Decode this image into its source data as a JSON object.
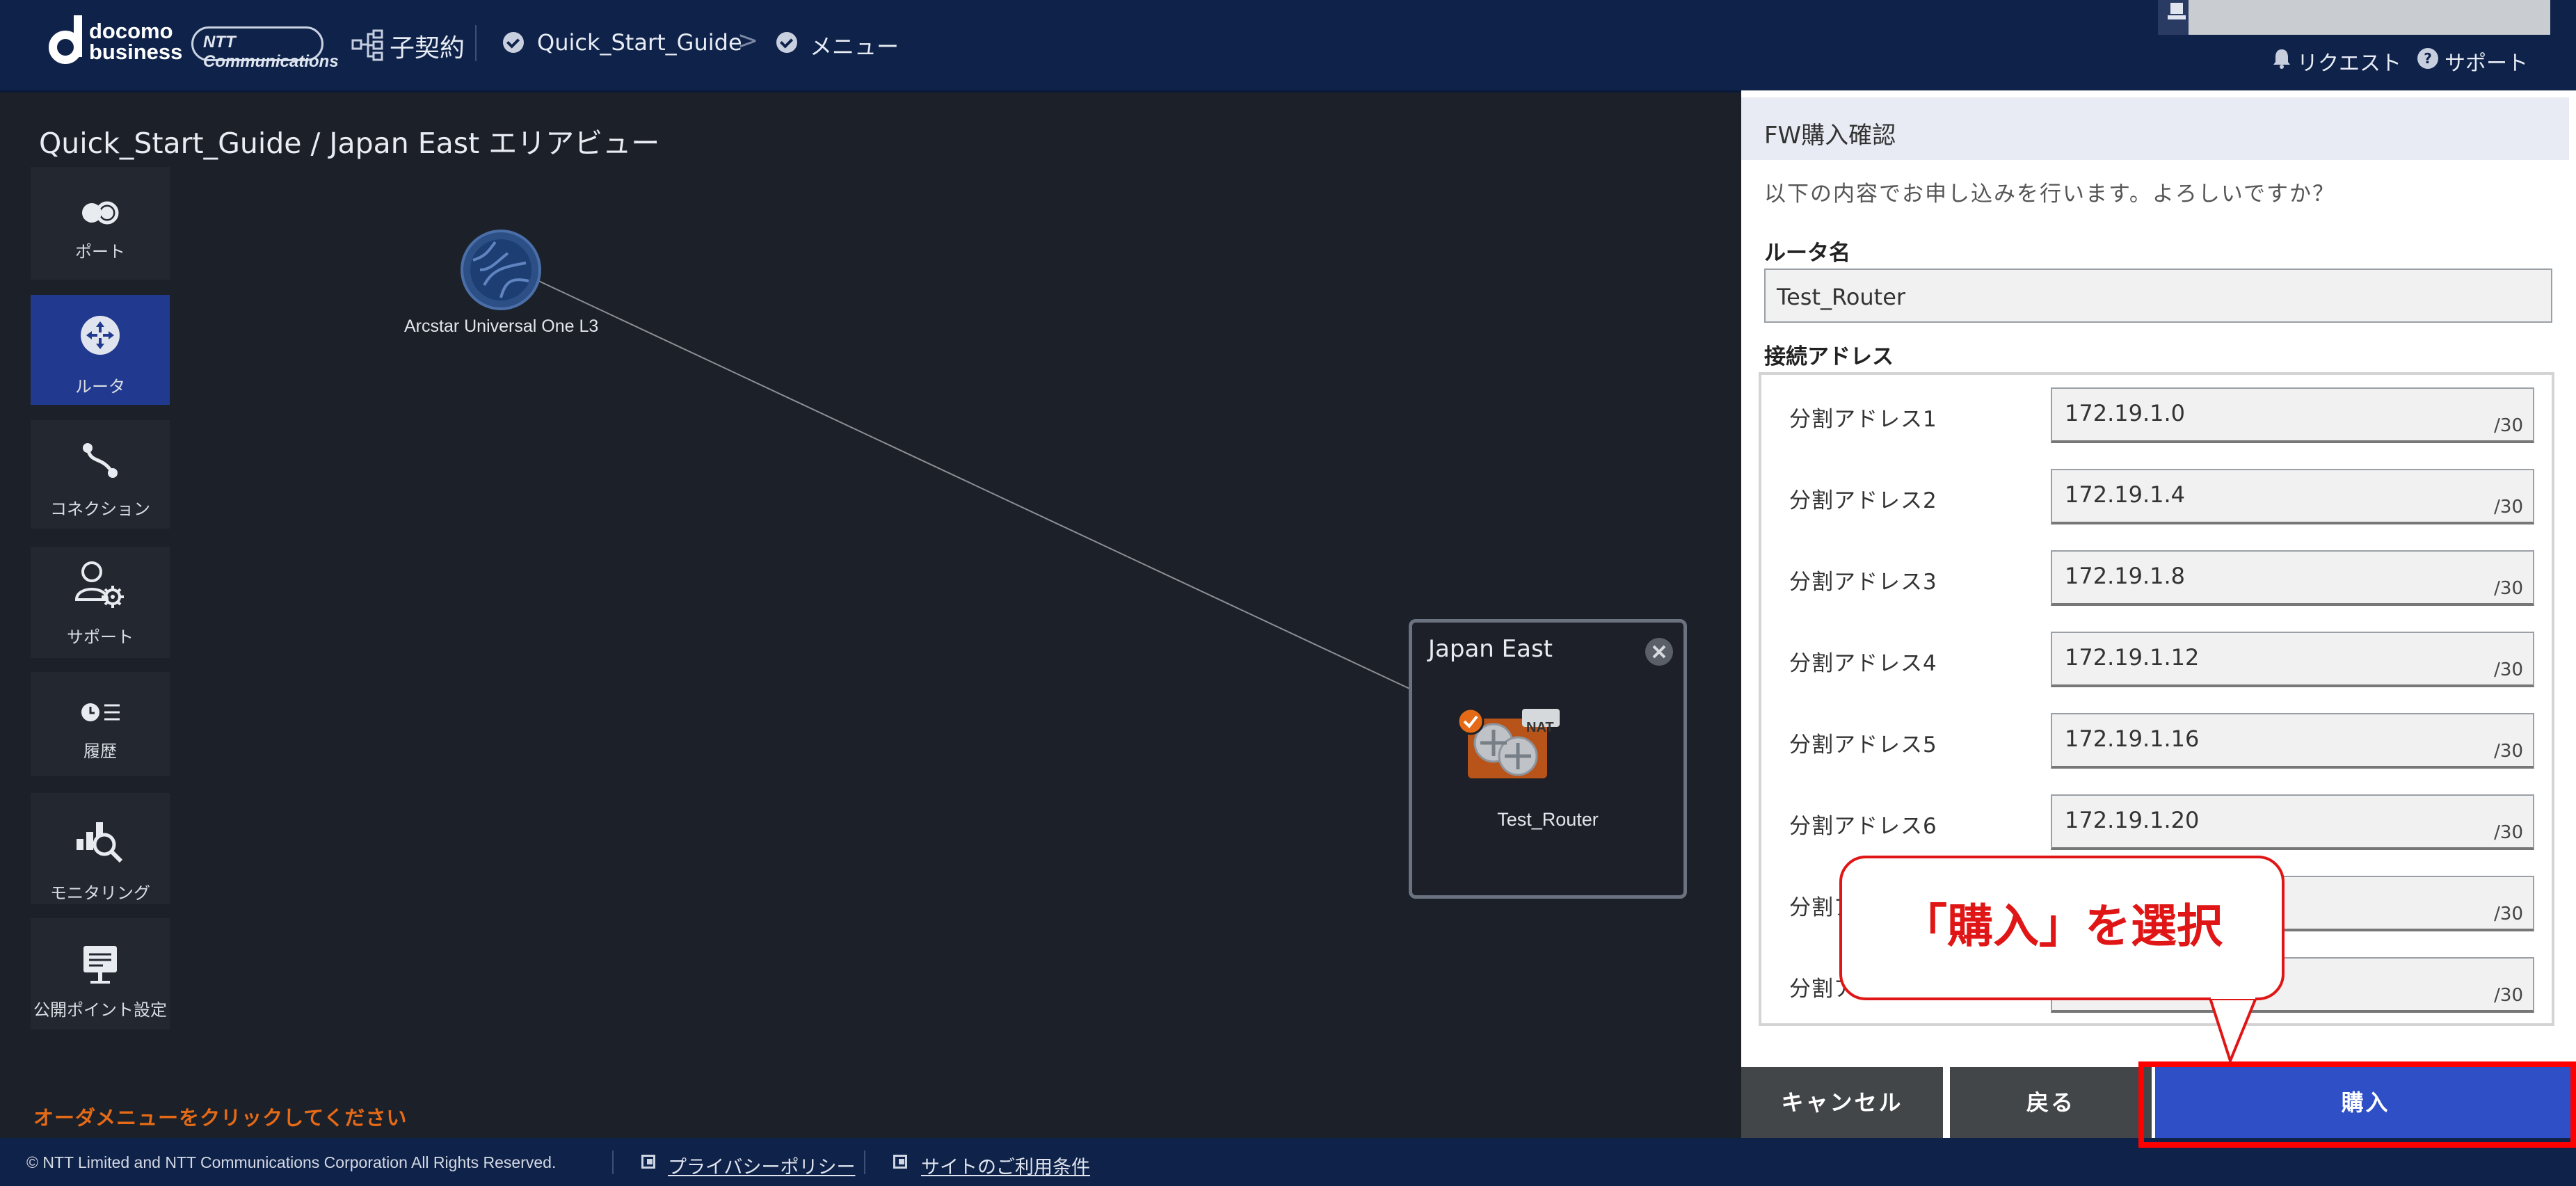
{
  "header": {
    "logo_line1": "docomo",
    "logo_line2": "business",
    "ntt_logo_text": "NTT Communications",
    "contract_label": "子契約",
    "breadcrumb_guide": "Quick_Start_Guide",
    "breadcrumb_separator": ">",
    "menu_label": "メニュー",
    "request_label": "リクエスト",
    "support_label": "サポート"
  },
  "area_title": "Quick_Start_Guide / Japan East エリアビュー",
  "sidebar": {
    "items": [
      {
        "label": "ポート",
        "icon": "port-icon"
      },
      {
        "label": "ルータ",
        "icon": "router-icon",
        "active": true
      },
      {
        "label": "コネクション",
        "icon": "connection-icon"
      },
      {
        "label": "サポート",
        "icon": "support-user-gear-icon"
      },
      {
        "label": "履歴",
        "icon": "history-icon"
      },
      {
        "label": "モニタリング",
        "icon": "monitoring-icon"
      },
      {
        "label": "公開ポイント設定",
        "icon": "public-point-icon"
      }
    ]
  },
  "canvas": {
    "network_node_label": "Arcstar Universal One L3",
    "region_title": "Japan East",
    "router_label": "Test_Router",
    "nat_badge": "NAT"
  },
  "order_hint": "オーダメニューをクリックしてください",
  "footer": {
    "copyright": "© NTT Limited and NTT Communications Corporation All Rights Reserved.",
    "privacy_link": "プライバシーポリシー",
    "terms_link": "サイトのご利用条件"
  },
  "panel": {
    "title": "FW購入確認",
    "confirm_message": "以下の内容でお申し込みを行います。よろしいですか？",
    "router_name_label": "ルータ名",
    "router_name_value": "Test_Router",
    "address_label": "接続アドレス",
    "addresses": [
      {
        "label": "分割アドレス1",
        "value": "172.19.1.0",
        "mask": "/30"
      },
      {
        "label": "分割アドレス2",
        "value": "172.19.1.4",
        "mask": "/30"
      },
      {
        "label": "分割アドレス3",
        "value": "172.19.1.8",
        "mask": "/30"
      },
      {
        "label": "分割アドレス4",
        "value": "172.19.1.12",
        "mask": "/30"
      },
      {
        "label": "分割アドレス5",
        "value": "172.19.1.16",
        "mask": "/30"
      },
      {
        "label": "分割アドレス6",
        "value": "172.19.1.20",
        "mask": "/30"
      },
      {
        "label": "分割ア",
        "value": "",
        "mask": "/30"
      },
      {
        "label": "分割ア",
        "value": "",
        "mask": "/30"
      }
    ],
    "cancel_label": "キャンセル",
    "back_label": "戻る",
    "buy_label": "購入"
  },
  "callout_text": "「購入」を選択",
  "colors": {
    "header_bg": "#0f2249",
    "active_sidebar": "#213a8f",
    "buy_button": "#2e4fc6",
    "annotation_red": "#e01616",
    "router_orange": "#e46a17"
  }
}
